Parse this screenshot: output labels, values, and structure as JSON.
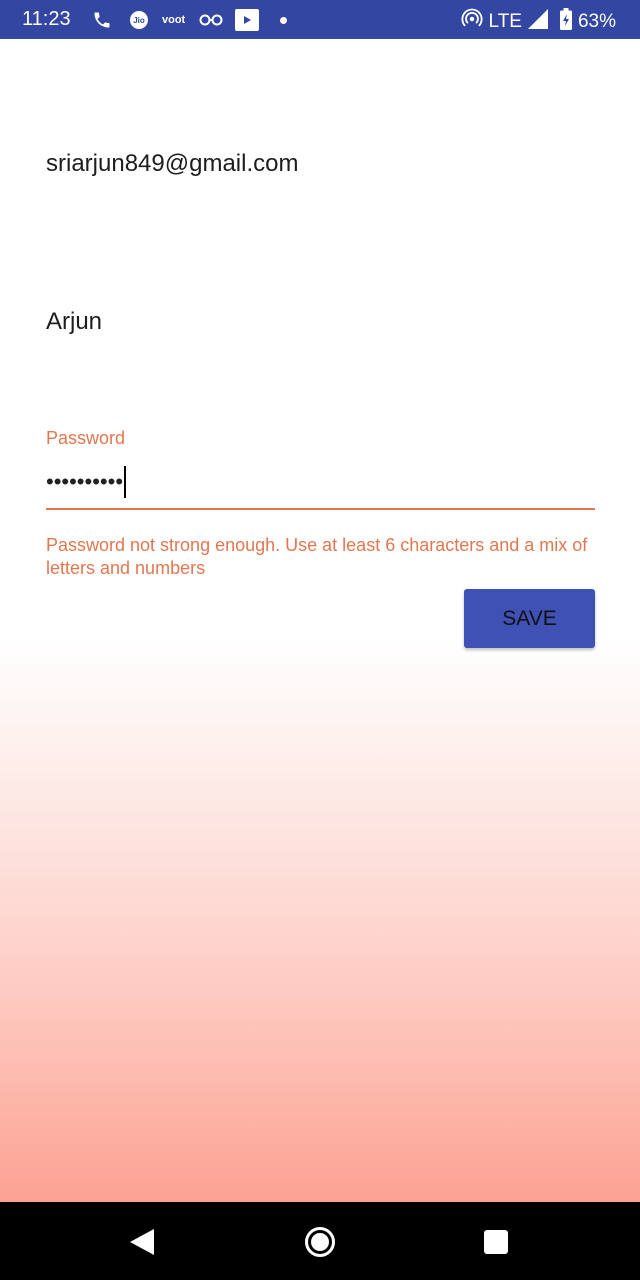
{
  "status_bar": {
    "time": "11:23",
    "icons": [
      "phone-icon",
      "jio-icon",
      "voot-icon",
      "glasses-icon",
      "tv-icon",
      "notification-dot-icon"
    ],
    "jio_label": "Jio",
    "voot_label": "voot",
    "network_label": "LTE",
    "battery_percent": "63%",
    "background_color": "#3346a2"
  },
  "form": {
    "email_value": "sriarjun849@gmail.com",
    "name_value": "Arjun",
    "password_label": "Password",
    "password_masked": "••••••••••",
    "password_error": "Password not strong enough. Use at least 6 characters and a mix of letters and numbers",
    "error_color": "#e2774f"
  },
  "save_button": {
    "label": "SAVE",
    "color": "#3f51b5"
  },
  "nav_bar": {
    "icons": [
      "back-icon",
      "home-icon",
      "recent-apps-icon"
    ]
  }
}
